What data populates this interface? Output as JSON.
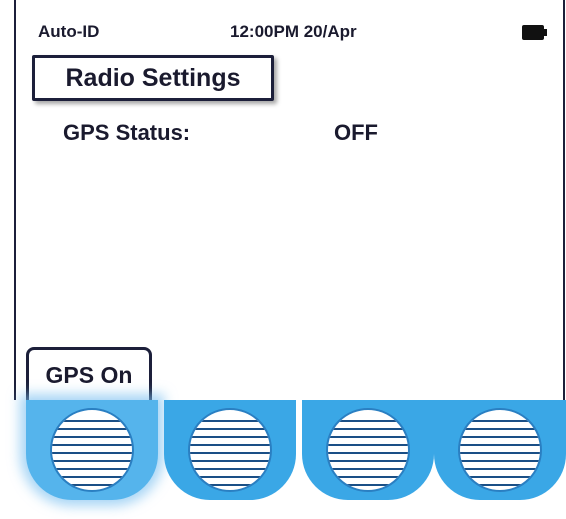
{
  "status_bar": {
    "mode": "Auto-ID",
    "time_date": "12:00PM 20/Apr",
    "battery_icon": "battery-full-icon"
  },
  "screen": {
    "title": "Radio Settings",
    "gps_status_label": "GPS Status:",
    "gps_status_value": "OFF"
  },
  "softkeys": {
    "left_label": "GPS On",
    "buttons": [
      {
        "name": "softkey-1",
        "active": true
      },
      {
        "name": "softkey-2",
        "active": false
      },
      {
        "name": "softkey-3",
        "active": false
      },
      {
        "name": "softkey-4",
        "active": false
      }
    ]
  },
  "colors": {
    "key_blue": "#3aa7e6",
    "frame": "#1c1f3a"
  }
}
